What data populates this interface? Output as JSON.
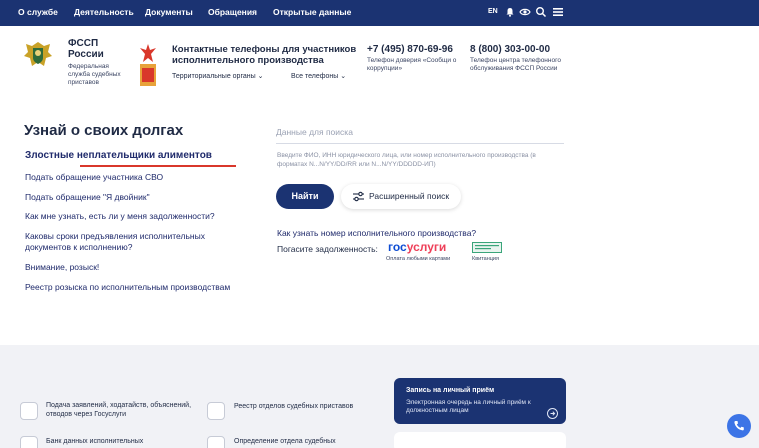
{
  "nav": {
    "items": [
      "О службе",
      "Деятельность",
      "Документы",
      "Обращения",
      "Открытые данные"
    ],
    "lang": "EN"
  },
  "header": {
    "org_title": "ФССП России",
    "org_subtitle": "Федеральная служба судебных приставов",
    "contacts_title": "Контактные телефоны для участников исполнительного производства",
    "dropdown_territorial": "Территориальные органы",
    "dropdown_all_phones": "Все телефоны",
    "phone1": "+7 (495) 870-69-96",
    "phone1_note": "Телефон доверия «Сообщи о коррупции»",
    "phone2": "8 (800) 303-00-00",
    "phone2_note": "Телефон центра телефонного обслуживания ФССП России"
  },
  "main": {
    "title": "Узнай о своих долгах",
    "links": [
      "Злостные неплательщики алиментов",
      "Подать обращение участника СВО",
      "Подать обращение \"Я двойник\"",
      "Как мне узнать, есть ли у меня задолженности?",
      "Каковы сроки предъявления исполнительных документов к исполнению?",
      "Внимание, розыск!",
      "Реестр розыска по исполнительным производствам"
    ],
    "search_placeholder": "Данные для поиска",
    "search_hint": "Введите ФИО, ИНН юридического лица, или номер исполнительного производства (в форматах N...N/YY/DD/RR или N...N/YY/DDDDD-ИП)",
    "find_button": "Найти",
    "advanced_button": "Расширенный поиск",
    "how_link": "Как узнать номер исполнительного производства?",
    "pay_label": "Погасите задолженность:",
    "gosuslugi_a": "гос",
    "gosuslugi_b": "услуги",
    "gosuslugi_sub": "Оплата любыми картами",
    "receipt_sub": "Квитанция"
  },
  "services": {
    "item1": "Подача заявлений, ходатайств, объяснений, отводов через Госуслуги",
    "item2": "Реестр отделов судебных приставов",
    "item3": "Банк данных исполнительных",
    "item4": "Определение отдела судебных",
    "reception_title": "Запись на личный приём",
    "reception_text": "Электронная очередь на личный приём к должностным лицам"
  },
  "colors": {
    "nav_bg": "#1b3372",
    "accent_red": "#d9372b",
    "gos_blue": "#0d4cd3",
    "gos_red": "#ee3f58"
  }
}
